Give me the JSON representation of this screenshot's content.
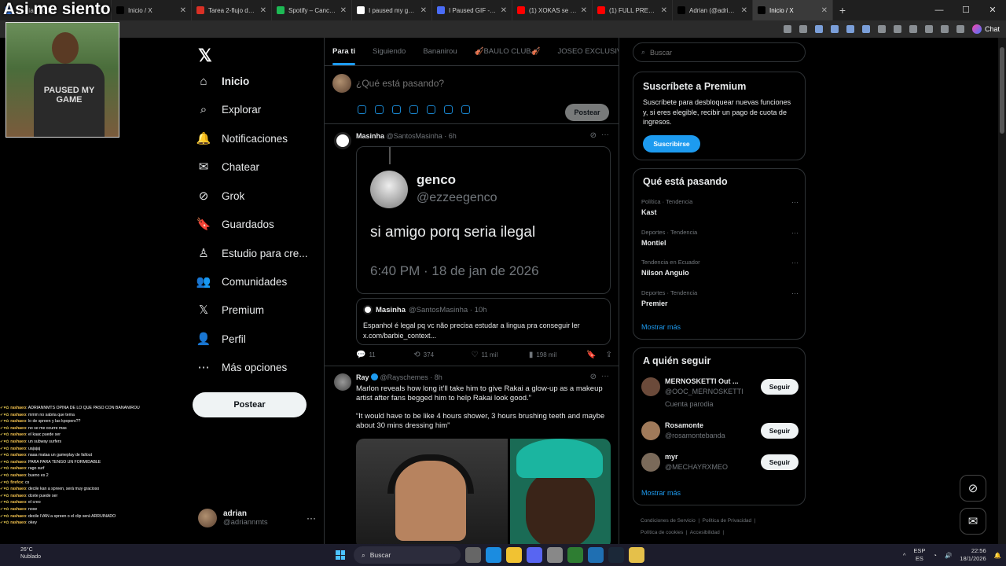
{
  "stream_overlay": {
    "title": "Asi me siento",
    "webcam_shirt": "PAUSED MY GAME",
    "chat": [
      {
        "user": "rashaeo",
        "text": "ADRIANNMTS OPINA DE LO QUE PASO CON BANANIROU"
      },
      {
        "user": "rashaeo",
        "text": "mmm no sabria que tema"
      },
      {
        "user": "rashaeo",
        "text": "lo de spreen y las kpopers??"
      },
      {
        "user": "rashaeo",
        "text": "no se me ocurre mas"
      },
      {
        "user": "rashaeo",
        "text": "el kaac puede ser"
      },
      {
        "user": "rashaeo",
        "text": "un subway surfers"
      },
      {
        "user": "rashaeo",
        "text": "uajajaj"
      },
      {
        "user": "rashaeo",
        "text": "naaa mataa un gameplay de fallout"
      },
      {
        "user": "rashaeo",
        "text": "PARA PARA TENGO UN FORMIDABLE"
      },
      {
        "user": "rashaeo",
        "text": "rago surf"
      },
      {
        "user": "rashaeo",
        "text": "bueno es 2"
      },
      {
        "user": "firefox",
        "text": "cs"
      },
      {
        "user": "rashaeo",
        "text": "decile kan a spreen, será muy gracioso"
      },
      {
        "user": "rashaeo",
        "text": "dcete puede ser"
      },
      {
        "user": "rashaeo",
        "text": "el creo"
      },
      {
        "user": "rashaeo",
        "text": "nose"
      },
      {
        "user": "rashaeo",
        "text": "decile IVAN a spreen o el clip será ARRUINADO"
      },
      {
        "user": "rashaeo",
        "text": "okey"
      }
    ]
  },
  "browser": {
    "tabs": [
      {
        "title": "Mi día - To Do",
        "color": "#3b82f6"
      },
      {
        "title": "Inicio / X",
        "color": "#000000"
      },
      {
        "title": "Tarea 2-flujo de trab",
        "color": "#d93025"
      },
      {
        "title": "Spotify – Canciones",
        "color": "#1db954"
      },
      {
        "title": "I paused my game t",
        "color": "#ffffff"
      },
      {
        "title": "I Paused GIF - I Pau",
        "color": "#4a6cf7"
      },
      {
        "title": "(1) XOKAS se METI",
        "color": "#ff0000"
      },
      {
        "title": "(1) FULL PRECISIÓN",
        "color": "#ff0000"
      },
      {
        "title": "Adrian (@adriannmt",
        "color": "#000000"
      },
      {
        "title": "Inicio / X",
        "color": "#000000"
      }
    ],
    "active_tab": 9,
    "new_tab": "+",
    "chat_button": "Chat"
  },
  "nav": {
    "items": [
      {
        "label": "Inicio",
        "icon": "home-icon",
        "glyph": "⌂"
      },
      {
        "label": "Explorar",
        "icon": "search-icon",
        "glyph": "⌕"
      },
      {
        "label": "Notificaciones",
        "icon": "bell-icon",
        "glyph": "🔔"
      },
      {
        "label": "Chatear",
        "icon": "mail-icon",
        "glyph": "✉"
      },
      {
        "label": "Grok",
        "icon": "grok-icon",
        "glyph": "⊘"
      },
      {
        "label": "Guardados",
        "icon": "bookmark-icon",
        "glyph": "🔖"
      },
      {
        "label": "Estudio para cre...",
        "icon": "studio-icon",
        "glyph": "♙"
      },
      {
        "label": "Comunidades",
        "icon": "communities-icon",
        "glyph": "👥"
      },
      {
        "label": "Premium",
        "icon": "x-premium-icon",
        "glyph": "𝕏"
      },
      {
        "label": "Perfil",
        "icon": "person-icon",
        "glyph": "👤"
      },
      {
        "label": "Más opciones",
        "icon": "more-circle-icon",
        "glyph": "⋯"
      }
    ],
    "post_label": "Postear",
    "profile": {
      "name": "adrian",
      "handle": "@adriannmts"
    }
  },
  "feed": {
    "tabs": [
      "Para ti",
      "Siguiendo",
      "Bananirou",
      "🎻BAULO CLUB🎻",
      "JOSEO EXCLUSIVE"
    ],
    "composer_placeholder": "¿Qué está pasando?",
    "composer_post": "Postear",
    "post1": {
      "name": "Masinha",
      "handle": "@SantosMasinha",
      "time": "· 6h",
      "embed": {
        "name": "genco",
        "handle": "@ezzeegenco",
        "text": "si amigo porq seria ilegal",
        "time": "6:40 PM · 18 de jan de 2026"
      },
      "quote": {
        "name": "Masinha",
        "handle": "@SantosMasinha · 10h",
        "text": "Espanhol é legal pq vc não precisa estudar a lingua pra conseguir ler x.com/barbie_context..."
      },
      "stats": {
        "replies": "11",
        "reposts": "374",
        "likes": "11 mil",
        "views": "198 mil"
      }
    },
    "post2": {
      "name": "Ray",
      "handle": "@Rayschemes",
      "time": "· 8h",
      "text1": "Marlon reveals how long it’ll take him to give Rakai a glow-up as a makeup artist after fans begged him to help Rakai look good.”",
      "text2": "“It would have to be like 4 hours shower, 3 hours brushing teeth and maybe about 30 mins dressing him”"
    }
  },
  "right": {
    "search_placeholder": "Buscar",
    "premium": {
      "title": "Suscríbete a Premium",
      "body": "Suscríbete para desbloquear nuevas funciones y, si eres elegible, recibir un pago de cuota de ingresos.",
      "button": "Suscribirse"
    },
    "trends": {
      "title": "Qué está pasando",
      "items": [
        {
          "category": "Política · Tendencia",
          "name": "Kast"
        },
        {
          "category": "Deportes · Tendencia",
          "name": "Montiel"
        },
        {
          "category": "Tendencia en Ecuador",
          "name": "Nilson Angulo"
        },
        {
          "category": "Deportes · Tendencia",
          "name": "Premier"
        }
      ],
      "more": "Mostrar más"
    },
    "follow": {
      "title": "A quién seguir",
      "items": [
        {
          "name": "MERNOSKETTI Out ...",
          "handle": "@OOC_MERNOSKETTI",
          "extra": "Cuenta parodia",
          "button": "Seguir"
        },
        {
          "name": "Rosamonte",
          "handle": "@rosamontebanda",
          "extra": "",
          "button": "Seguir"
        },
        {
          "name": "myr",
          "handle": "@MECHAYRXMEO",
          "extra": "",
          "button": "Seguir"
        }
      ],
      "more": "Mostrar más"
    },
    "legal": [
      "Condiciones de Servicio",
      "Política de Privacidad",
      "Política de cookies",
      "Accesibilidad"
    ]
  },
  "taskbar": {
    "weather_temp": "26°C",
    "weather_desc": "Nublado",
    "search": "Buscar",
    "lang1": "ESP",
    "lang2": "ES",
    "time": "22:56",
    "date": "18/1/2026"
  }
}
